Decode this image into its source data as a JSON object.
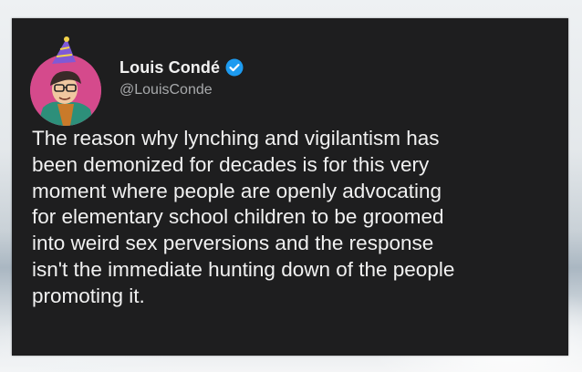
{
  "author": {
    "display_name": "Louis Condé",
    "handle": "@LouisConde",
    "verified": true,
    "avatar_icon": "cartoon-avatar-icon",
    "verified_icon": "verified-badge-icon",
    "verified_color": "#1d9bf0"
  },
  "tweet": {
    "lines": [
      "The reason why lynching and vigilantism has",
      "been demonized for decades is for this very",
      "moment where people are openly advocating",
      "for elementary school children to be groomed",
      "into weird sex perversions and the response",
      "isn't the immediate hunting down of the people",
      "promoting it."
    ]
  },
  "colors": {
    "card_background": "#1e1e1f",
    "text": "#f1f1f1",
    "handle_text": "#a7a9ab",
    "avatar_background": "#d54a8c"
  }
}
